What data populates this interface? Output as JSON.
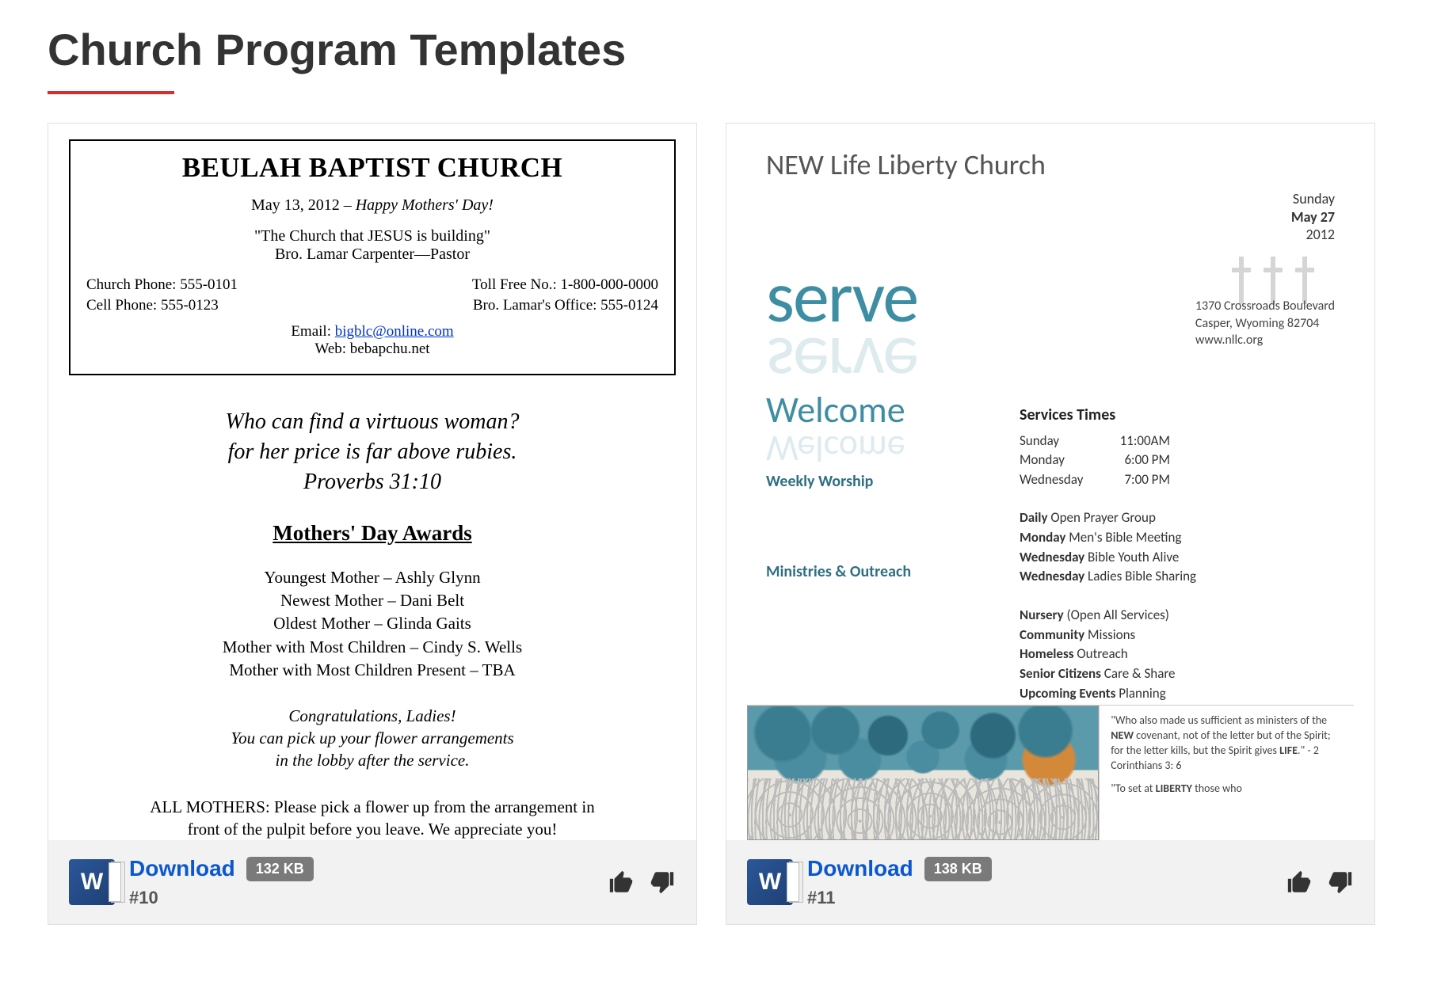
{
  "page": {
    "title": "Church Program Templates"
  },
  "cards": [
    {
      "download_label": "Download",
      "size": "132 KB",
      "number": "#10",
      "t1": {
        "church_name": "BEULAH BAPTIST CHURCH",
        "date_prefix": "May 13, 2012 – ",
        "date_italic": "Happy Mothers' Day!",
        "slogan": "\"The Church that JESUS is building\"",
        "pastor": "Bro. Lamar Carpenter—Pastor",
        "church_phone": "Church Phone: 555-0101",
        "cell_phone": "Cell Phone: 555-0123",
        "tollfree": "Toll Free No.: 1-800-000-0000",
        "office": "Bro. Lamar's Office: 555-0124",
        "email_label": "Email: ",
        "email": "bigblc@online.com",
        "web": "Web: bebapchu.net",
        "script1": "Who can find a virtuous woman?",
        "script2": "for her price is far above rubies.",
        "script3": "Proverbs 31:10",
        "awards_head": "Mothers' Day Awards",
        "award1": "Youngest Mother – Ashly Glynn",
        "award2": "Newest Mother – Dani Belt",
        "award3": "Oldest Mother – Glinda Gaits",
        "award4": "Mother with Most Children – Cindy S. Wells",
        "award5": "Mother with Most Children Present – TBA",
        "congrats1": "Congratulations, Ladies!",
        "congrats2": "You can pick up your flower arrangements",
        "congrats3": "in the lobby after the service.",
        "allmothers1": "ALL MOTHERS: Please pick a flower up from the arrangement in",
        "allmothers2": "front of the pulpit before you leave.  We appreciate you!"
      }
    },
    {
      "download_label": "Download",
      "size": "138 KB",
      "number": "#11",
      "t2": {
        "church_name": "NEW Life Liberty Church",
        "serve": "serve",
        "date_day": "Sunday",
        "date_bold": "May 27",
        "date_year": "2012",
        "addr1": "1370 Crossroads Boulevard",
        "addr2": "Casper, Wyoming 82704",
        "addr3": "www.nllc.org",
        "welcome": "Welcome",
        "weekly": "Weekly Worship",
        "ministries": "Ministries & Outreach",
        "services_head": "Services Times",
        "svc_sun_d": "Sunday",
        "svc_sun_t": "11:00AM",
        "svc_mon_d": "Monday",
        "svc_mon_t": "6:00 PM",
        "svc_wed_d": "Wednesday",
        "svc_wed_t": "7:00 PM",
        "w_daily_b": "Daily",
        "w_daily": " Open Prayer Group",
        "w_mon_b": "Monday",
        "w_mon": " Men's Bible Meeting",
        "w_wed1_b": "Wednesday",
        "w_wed1": " Bible Youth Alive",
        "w_wed2_b": "Wednesday",
        "w_wed2": " Ladies Bible Sharing",
        "m_nur_b": "Nursery",
        "m_nur": " (Open All Services)",
        "m_com_b": "Community",
        "m_com": " Missions",
        "m_hom_b": "Homeless",
        "m_hom": " Outreach",
        "m_sen_b": "Senior Citizens",
        "m_sen": " Care & Share",
        "m_up_b": "Upcoming Events",
        "m_up": " Planning",
        "quote1a": "\"Who also made us sufficient as ministers of the ",
        "quote1b": "NEW",
        "quote1c": " covenant, not of the letter but of the Spirit; for the letter kills, but the Spirit gives ",
        "quote1d": "LIFE",
        "quote1e": ".\"  - 2 Corinthians 3: 6",
        "quote2a": "\"To set at ",
        "quote2b": "LIBERTY",
        "quote2c": " those who"
      }
    }
  ]
}
